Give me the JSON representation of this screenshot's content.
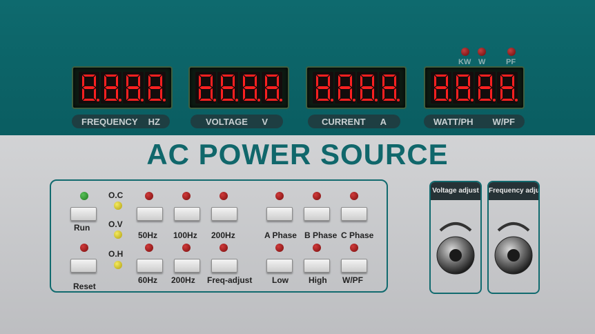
{
  "displays": [
    {
      "id": "frequency",
      "readout": "8.8.8.8.",
      "label_left": "FREQUENCY",
      "label_right": "HZ"
    },
    {
      "id": "voltage",
      "readout": "8.8.8.8.",
      "label_left": "VOLTAGE",
      "label_right": "V"
    },
    {
      "id": "current",
      "readout": "8.8.8.8.",
      "label_left": "CURRENT",
      "label_right": "A"
    },
    {
      "id": "watt",
      "readout": "8.8.8.8.",
      "label_left": "WATT/PH",
      "label_right": "W/PF"
    }
  ],
  "watt_indicators": [
    "KW",
    "W",
    "PF"
  ],
  "title": "AC POWER SOURCE",
  "controls": {
    "run": "Run",
    "reset": "Reset",
    "flags": [
      "O.C",
      "O.V",
      "O.H"
    ],
    "freq_top": [
      "50Hz",
      "100Hz",
      "200Hz"
    ],
    "freq_bottom": [
      "60Hz",
      "200Hz",
      "Freq-adjust"
    ],
    "phase": [
      "A Phase",
      "B Phase",
      "C Phase"
    ],
    "range": [
      "Low",
      "High",
      "W/PF"
    ]
  },
  "knobs": {
    "voltage": "Voltage adjust",
    "frequency": "Frequency adjust"
  },
  "colors": {
    "teal": "#0e6a6e",
    "led_red": "#c03030",
    "led_green": "#3aa83a",
    "led_yellow": "#e0d030",
    "segment": "#ff2020"
  }
}
